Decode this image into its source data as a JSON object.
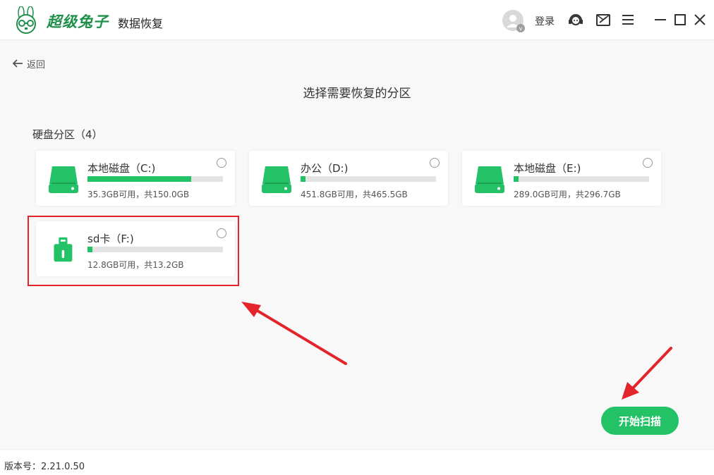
{
  "app": {
    "brand_name": "超级兔子",
    "brand_sub": "数据恢复",
    "login_label": "登录",
    "avatar_badge": "v"
  },
  "nav": {
    "back_label": "返回"
  },
  "main": {
    "title": "选择需要恢复的分区",
    "section_label": "硬盘分区（4）"
  },
  "drives": [
    {
      "name": "本地磁盘（C:)",
      "caption": "35.3GB可用，共150.0GB",
      "used_fraction": 0.765,
      "icon": "hard-drive-icon"
    },
    {
      "name": "办公（D:)",
      "caption": "451.8GB可用，共465.5GB",
      "used_fraction": 0.029,
      "icon": "hard-drive-icon"
    },
    {
      "name": "本地磁盘（E:)",
      "caption": "289.0GB可用，共296.7GB",
      "used_fraction": 0.026,
      "icon": "hard-drive-icon"
    },
    {
      "name": "sd卡（F:)",
      "caption": "12.8GB可用，共13.2GB",
      "used_fraction": 0.03,
      "icon": "sd-card-icon"
    }
  ],
  "actions": {
    "scan_label": "开始扫描"
  },
  "footer": {
    "version": "版本号：2.21.0.50"
  },
  "colors": {
    "accent": "#24c267",
    "annotation": "#e3242b",
    "brand": "#1f8f4a"
  }
}
